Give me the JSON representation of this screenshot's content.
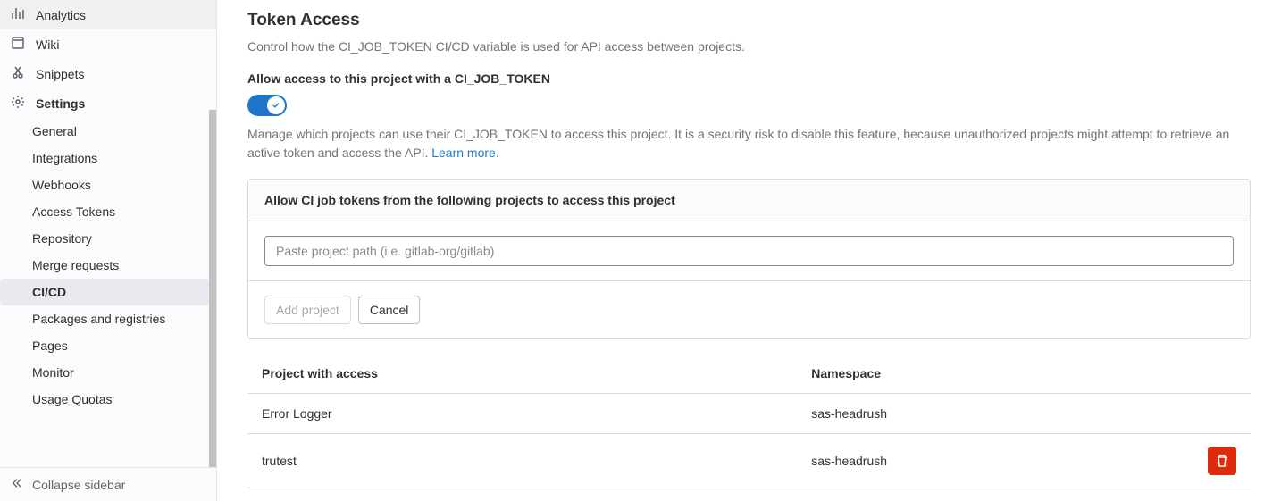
{
  "sidebar": {
    "top_items": [
      {
        "icon": "analytics",
        "label": "Analytics",
        "name": "sidebar-item-analytics"
      },
      {
        "icon": "wiki",
        "label": "Wiki",
        "name": "sidebar-item-wiki"
      },
      {
        "icon": "snippets",
        "label": "Snippets",
        "name": "sidebar-item-snippets"
      },
      {
        "icon": "settings",
        "label": "Settings",
        "name": "sidebar-item-settings",
        "bold": true
      }
    ],
    "settings_children": [
      {
        "label": "General",
        "name": "sidebar-sub-general"
      },
      {
        "label": "Integrations",
        "name": "sidebar-sub-integrations"
      },
      {
        "label": "Webhooks",
        "name": "sidebar-sub-webhooks"
      },
      {
        "label": "Access Tokens",
        "name": "sidebar-sub-access-tokens"
      },
      {
        "label": "Repository",
        "name": "sidebar-sub-repository"
      },
      {
        "label": "Merge requests",
        "name": "sidebar-sub-merge-requests"
      },
      {
        "label": "CI/CD",
        "name": "sidebar-sub-cicd",
        "active": true
      },
      {
        "label": "Packages and registries",
        "name": "sidebar-sub-packages"
      },
      {
        "label": "Pages",
        "name": "sidebar-sub-pages"
      },
      {
        "label": "Monitor",
        "name": "sidebar-sub-monitor"
      },
      {
        "label": "Usage Quotas",
        "name": "sidebar-sub-usage-quotas"
      }
    ],
    "collapse_label": "Collapse sidebar"
  },
  "main": {
    "title": "Token Access",
    "subtitle": "Control how the CI_JOB_TOKEN CI/CD variable is used for API access between projects.",
    "toggle_label": "Allow access to this project with a CI_JOB_TOKEN",
    "toggle_on": true,
    "description": "Manage which projects can use their CI_JOB_TOKEN to access this project. It is a security risk to disable this feature, because unauthorized projects might attempt to retrieve an active token and access the API. ",
    "learn_more": "Learn more.",
    "panel_header": "Allow CI job tokens from the following projects to access this project",
    "input_placeholder": "Paste project path (i.e. gitlab-org/gitlab)",
    "add_label": "Add project",
    "cancel_label": "Cancel",
    "table": {
      "col_project": "Project with access",
      "col_namespace": "Namespace",
      "rows": [
        {
          "project": "Error Logger",
          "namespace": "sas-headrush",
          "deletable": false
        },
        {
          "project": "trutest",
          "namespace": "sas-headrush",
          "deletable": true
        }
      ]
    }
  }
}
